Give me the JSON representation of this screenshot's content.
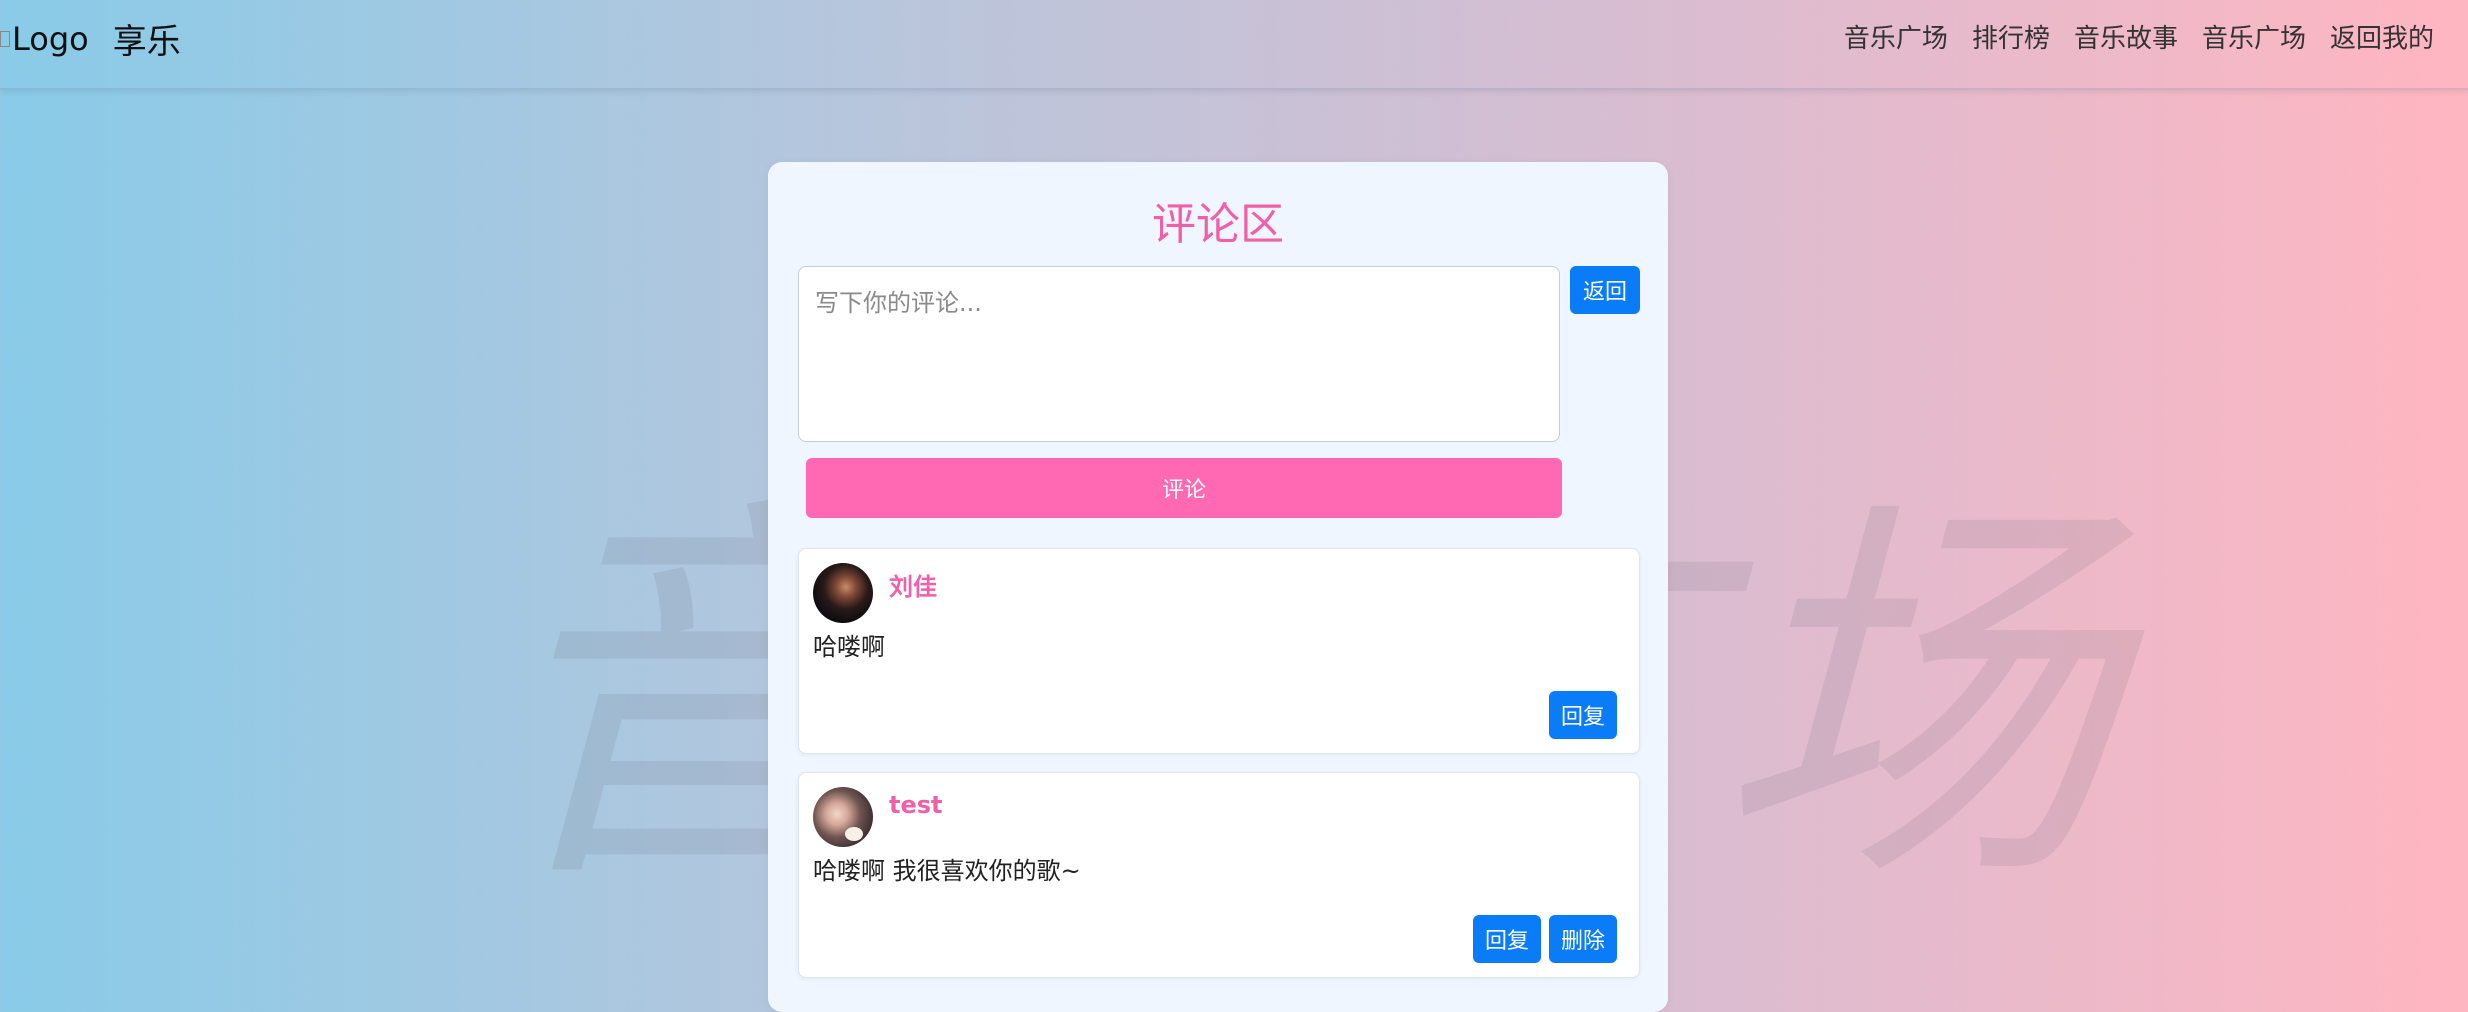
{
  "header": {
    "logo_alt": "Logo",
    "brand": "享乐",
    "nav": [
      "音乐广场",
      "排行榜",
      "音乐故事",
      "音乐广场",
      "返回我的"
    ]
  },
  "watermark": "音乐广场",
  "panel": {
    "title": "评论区",
    "input_placeholder": "写下你的评论...",
    "back_label": "返回",
    "submit_label": "评论"
  },
  "comments": [
    {
      "user": "刘佳",
      "text": "哈喽啊",
      "actions": [
        "回复"
      ]
    },
    {
      "user": "test",
      "text": "哈喽啊 我很喜欢你的歌~",
      "actions": [
        "回复",
        "删除"
      ]
    }
  ],
  "colors": {
    "accent_pink": "#f25fa8",
    "button_pink": "#ff69b4",
    "button_blue": "#0b7cf7"
  }
}
